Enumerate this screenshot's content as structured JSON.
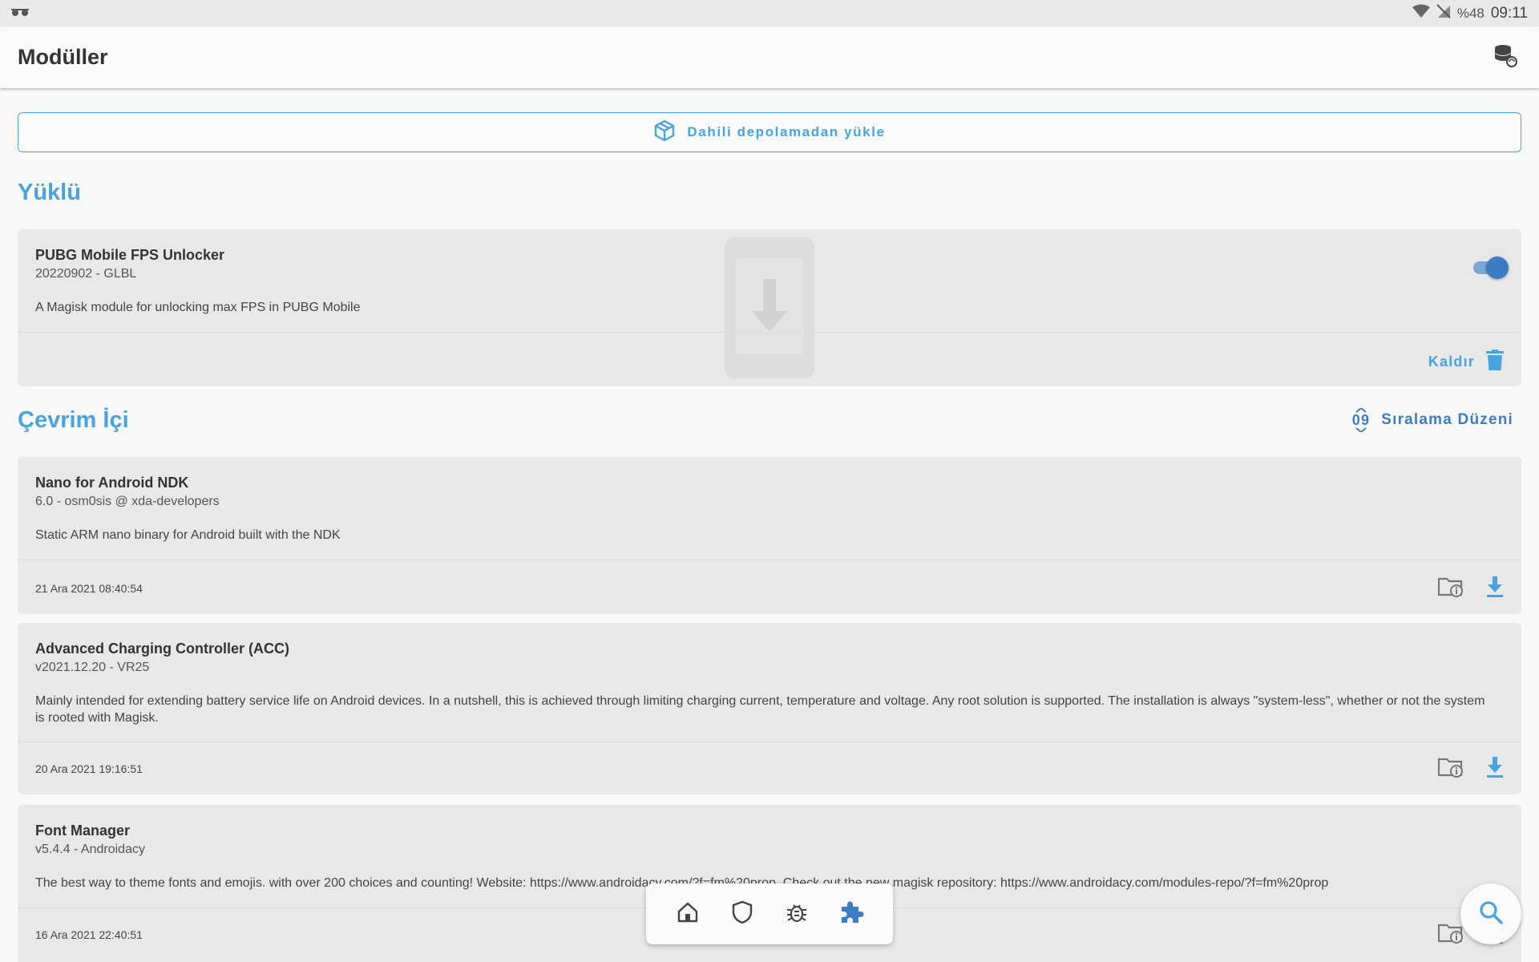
{
  "status_bar": {
    "battery": "%48",
    "time": "09:11"
  },
  "app_bar": {
    "title": "Modüller"
  },
  "install_button": {
    "label": "Dahili depolamadan yükle"
  },
  "installed": {
    "title": "Yüklü",
    "modules": [
      {
        "name": "PUBG Mobile FPS Unlocker",
        "version": "20220902 - GLBL",
        "description": "A Magisk module for unlocking max FPS in PUBG Mobile",
        "enabled": true,
        "remove_label": "Kaldır"
      }
    ]
  },
  "online": {
    "title": "Çevrim İçi",
    "sort_label": "Sıralama Düzeni",
    "sort_icon_text": "09",
    "modules": [
      {
        "name": "Nano for Android NDK",
        "version": "6.0 - osm0sis @ xda-developers",
        "description": "Static ARM nano binary for Android built with the NDK",
        "date": "21 Ara 2021 08:40:54"
      },
      {
        "name": "Advanced Charging Controller (ACC)",
        "version": "v2021.12.20 - VR25",
        "description": "Mainly intended for extending battery service life on Android devices. In a nutshell, this is achieved through limiting charging current, temperature and voltage. Any root solution is supported. The installation is always \"system-less\", whether or not the system is rooted with Magisk.",
        "date": "20 Ara 2021 19:16:51"
      },
      {
        "name": "Font Manager",
        "version": "v5.4.4 - Androidacy",
        "description": "The best way to theme fonts and emojis. with over 200 choices and counting! Website: https://www.androidacy.com/?f=fm%20prop. Check out the new magisk repository: https://www.androidacy.com/modules-repo/?f=fm%20prop",
        "date": "16 Ara 2021 22:40:51"
      }
    ]
  },
  "bottom_nav": {
    "items": [
      "home-icon",
      "shield-icon",
      "bug-icon",
      "puzzle-icon"
    ],
    "active": "puzzle-icon"
  },
  "colors": {
    "accent": "#4aa3df",
    "accent_dark": "#3d7bc4",
    "card_bg": "#e8e8e8",
    "page_bg": "#f9f9f9"
  }
}
